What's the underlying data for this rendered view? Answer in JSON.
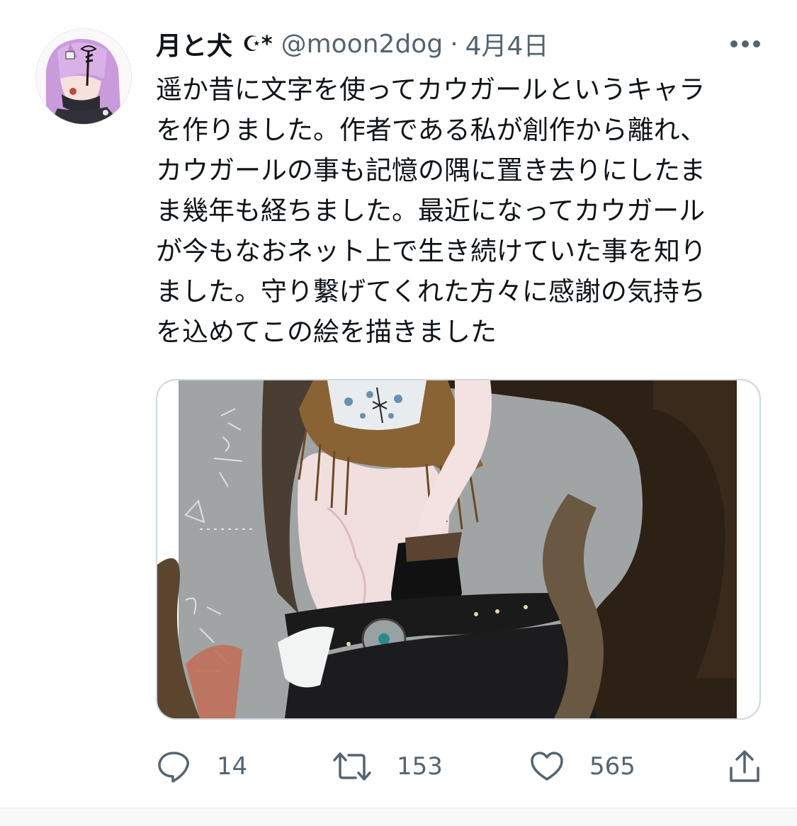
{
  "tweet": {
    "display_name": "月と犬",
    "display_emoji": "☪*",
    "handle": "@moon2dog",
    "separator": "·",
    "date": "4月4日",
    "text": "遥か昔に文字を使ってカウガールというキャラ\nを作りました。作者である私が創作から離れ、\nカウガールの事も記憶の隅に置き去りにしたま\nま幾年も経ちました。最近になってカウガール\nが今もなおネット上で生き続けていた事を知り\nました。守り繋げてくれた方々に感謝の気持ち\nを込めてこの絵を描きました",
    "media_alt": "illustration",
    "more_icon": "more-horizontal-icon"
  },
  "actions": {
    "reply": {
      "icon": "reply-icon",
      "count": "14"
    },
    "retweet": {
      "icon": "retweet-icon",
      "count": "153"
    },
    "like": {
      "icon": "heart-icon",
      "count": "565"
    },
    "share": {
      "icon": "share-icon"
    }
  },
  "colors": {
    "text": "#0f1419",
    "secondary": "#536471",
    "border": "#cfd9de"
  }
}
